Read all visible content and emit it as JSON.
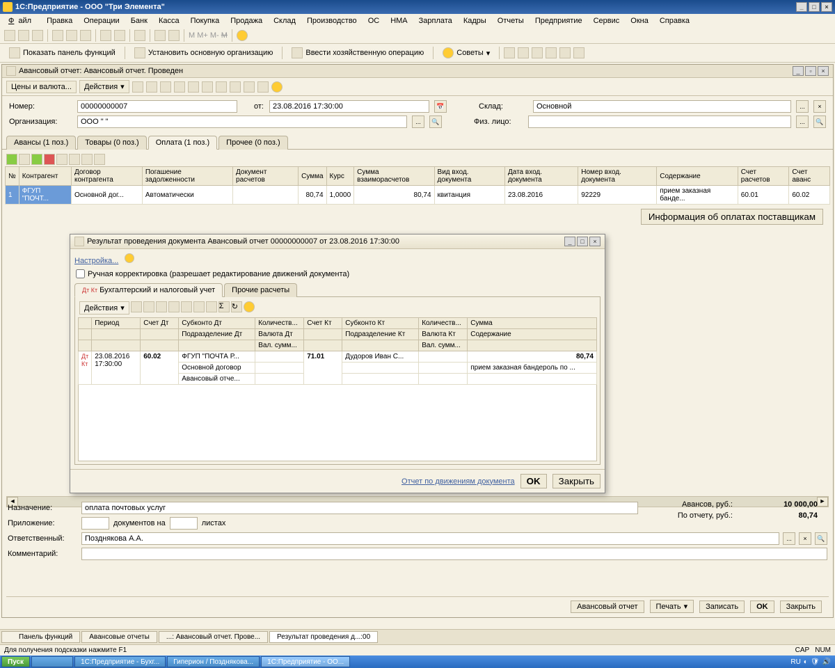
{
  "app": {
    "title": "1С:Предприятие - ООО \"Три Элемента\""
  },
  "menu": [
    "Файл",
    "Правка",
    "Операции",
    "Банк",
    "Касса",
    "Покупка",
    "Продажа",
    "Склад",
    "Производство",
    "ОС",
    "НМА",
    "Зарплата",
    "Кадры",
    "Отчеты",
    "Предприятие",
    "Сервис",
    "Окна",
    "Справка"
  ],
  "toolbar2": {
    "show_panel": "Показать панель функций",
    "set_org": "Установить основную организацию",
    "enter_op": "Ввести хозяйственную операцию",
    "advice": "Советы"
  },
  "doc": {
    "title": "Авансовый отчет: Авансовый отчет. Проведен",
    "prices_currency": "Цены и валюта...",
    "actions": "Действия",
    "header": {
      "number_label": "Номер:",
      "number": "00000000007",
      "date_label": "от:",
      "date": "23.08.2016 17:30:00",
      "warehouse_label": "Склад:",
      "warehouse": "Основной",
      "org_label": "Организация:",
      "org": "ООО \"                     \"",
      "person_label": "Физ. лицо:",
      "person": ""
    },
    "tabs": [
      "Авансы (1 поз.)",
      "Товары (0 поз.)",
      "Оплата (1 поз.)",
      "Прочее (0 поз.)"
    ],
    "active_tab": 2,
    "grid_headers": [
      "№",
      "Контрагент",
      "Договор контрагента",
      "Погашение задолженности",
      "Документ расчетов",
      "Сумма",
      "Курс",
      "Сумма взаиморасчетов",
      "Вид вход. документа",
      "Дата вход. документа",
      "Номер вход. документа",
      "Содержание",
      "Счет расчетов",
      "Счет аванс"
    ],
    "grid_rows": [
      {
        "n": "1",
        "contragent": "ФГУП \"ПОЧТ...",
        "contract": "Основной дог...",
        "pay": "Автоматически",
        "docset": "",
        "sum": "80,74",
        "rate": "1,0000",
        "sumvz": "80,74",
        "kind": "квитанция",
        "date": "23.08.2016",
        "num": "92229",
        "content": "прием заказная банде...",
        "acct": "60.01",
        "acctav": "60.02"
      }
    ],
    "info_button": "Информация об оплатах поставщикам"
  },
  "modal": {
    "title": "Результат проведения документа Авансовый отчет 00000000007 от 23.08.2016 17:30:00",
    "settings": "Настройка...",
    "manual_chk": "Ручная корректировка (разрешает редактирование движений документа)",
    "tabs": [
      "Бухгалтерский и налоговый учет",
      "Прочие расчеты"
    ],
    "actions": "Действия",
    "headers_top": [
      "",
      "Период",
      "Счет Дт",
      "Субконто Дт",
      "Количеств...",
      "Счет Кт",
      "Субконто Кт",
      "Количеств...",
      "Сумма"
    ],
    "headers_mid": [
      "",
      "",
      "",
      "Подразделение Дт",
      "Валюта Дт",
      "",
      "Подразделение Кт",
      "Валюта Кт",
      "Содержание"
    ],
    "headers_bot": [
      "",
      "",
      "",
      "",
      "Вал. сумм...",
      "",
      "",
      "Вал. сумм...",
      ""
    ],
    "row": {
      "period": "23.08.2016 17:30:00",
      "dt": "60.02",
      "sub_dt_1": "ФГУП \"ПОЧТА Р...",
      "sub_dt_2": "Основной договор",
      "sub_dt_3": "Авансовый отче...",
      "kt": "71.01",
      "sub_kt": "Дудоров  Иван С...",
      "sum": "80,74",
      "content": "прием заказная бандероль по ..."
    },
    "footer_link": "Отчет по движениям документа",
    "ok": "OK",
    "close": "Закрыть"
  },
  "bottom": {
    "purpose_label": "Назначение:",
    "purpose": "оплата почтовых услуг",
    "attach_label": "Приложение:",
    "docs_on": "документов на",
    "sheets": "листах",
    "responsible_label": "Ответственный:",
    "responsible": "Позднякова А.А.",
    "comment_label": "Комментарий:",
    "totals": {
      "advances_label": "Авансов, руб.:",
      "advances": "10 000,00",
      "report_label": "По отчету, руб.:",
      "report": "80,74"
    }
  },
  "doc_footer": {
    "adv_report": "Авансовый отчет",
    "print": "Печать",
    "save": "Записать",
    "ok": "OK",
    "close": "Закрыть"
  },
  "window_tabs": [
    "Панель функций",
    "Авансовые отчеты",
    "...: Авансовый отчет. Прове...",
    "Результат проведения д...:00"
  ],
  "statusbar": {
    "hint": "Для получения подсказки нажмите F1",
    "cap": "CAP",
    "num": "NUM"
  },
  "taskbar": {
    "start": "Пуск",
    "items": [
      "1С:Предприятие - Бухг...",
      "Гиперион / Позднякова...",
      "1С:Предприятие - ОО..."
    ],
    "lang": "RU"
  }
}
